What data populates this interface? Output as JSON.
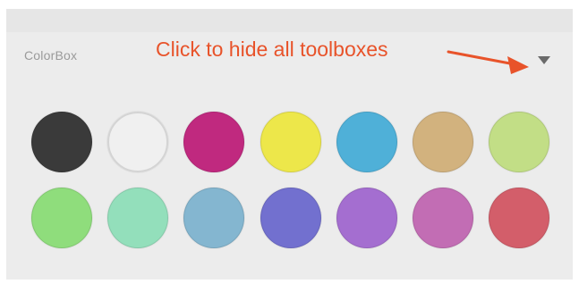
{
  "colorbox": {
    "title": "ColorBox",
    "annotation": "Click to hide all toolboxes",
    "annotation_color": "#e8532a",
    "toggle_icon": "triangle-down-icon",
    "colors_row1": [
      "#3a3a3a",
      "#f0f0f0",
      "#c0297f",
      "#ede74a",
      "#4fb0d8",
      "#d2b27e",
      "#c2de86"
    ],
    "colors_row2": [
      "#8fdd7c",
      "#93dfbb",
      "#84b6d0",
      "#7270cf",
      "#a46ed0",
      "#c26db4",
      "#d35e6a"
    ]
  }
}
